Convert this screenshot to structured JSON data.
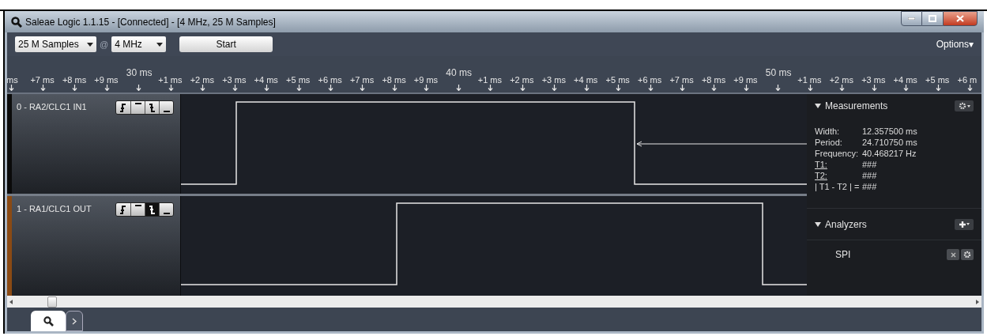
{
  "window": {
    "title": "Saleae Logic 1.1.15 - [Connected] - [4 MHz, 25 M Samples]"
  },
  "toolbar": {
    "samples": "25 M Samples",
    "at": "@",
    "rate": "4 MHz",
    "start": "Start",
    "options": "Options▾"
  },
  "ruler": {
    "ticks": [
      {
        "kind": "minor",
        "label": "ms"
      },
      {
        "kind": "minor",
        "label": "+7 ms"
      },
      {
        "kind": "minor",
        "label": "+8 ms"
      },
      {
        "kind": "minor",
        "label": "+9 ms"
      },
      {
        "kind": "major",
        "label": "30 ms"
      },
      {
        "kind": "minor",
        "label": "+1 ms"
      },
      {
        "kind": "minor",
        "label": "+2 ms"
      },
      {
        "kind": "minor",
        "label": "+3 ms"
      },
      {
        "kind": "minor",
        "label": "+4 ms"
      },
      {
        "kind": "minor",
        "label": "+5 ms"
      },
      {
        "kind": "minor",
        "label": "+6 ms"
      },
      {
        "kind": "minor",
        "label": "+7 ms"
      },
      {
        "kind": "minor",
        "label": "+8 ms"
      },
      {
        "kind": "minor",
        "label": "+9 ms"
      },
      {
        "kind": "major",
        "label": "40 ms"
      },
      {
        "kind": "minor",
        "label": "+1 ms"
      },
      {
        "kind": "minor",
        "label": "+2 ms"
      },
      {
        "kind": "minor",
        "label": "+3 ms"
      },
      {
        "kind": "minor",
        "label": "+4 ms"
      },
      {
        "kind": "minor",
        "label": "+5 ms"
      },
      {
        "kind": "minor",
        "label": "+6 ms"
      },
      {
        "kind": "minor",
        "label": "+7 ms"
      },
      {
        "kind": "minor",
        "label": "+8 ms"
      },
      {
        "kind": "minor",
        "label": "+9 ms"
      },
      {
        "kind": "major",
        "label": "50 ms"
      },
      {
        "kind": "minor",
        "label": "+1 ms"
      },
      {
        "kind": "minor",
        "label": "+2 ms"
      },
      {
        "kind": "minor",
        "label": "+3 ms"
      },
      {
        "kind": "minor",
        "label": "+4 ms"
      },
      {
        "kind": "minor",
        "label": "+5 ms"
      },
      {
        "kind": "minor",
        "label": "+6 m"
      }
    ]
  },
  "channels": [
    {
      "name": "0 - RA2/CLC1 IN1",
      "color": "#0a0a0a",
      "triggers": [
        {
          "kind": "rising",
          "selected": false
        },
        {
          "kind": "high",
          "selected": false
        },
        {
          "kind": "falling",
          "selected": false
        },
        {
          "kind": "low",
          "selected": false
        }
      ]
    },
    {
      "name": "1 - RA1/CLC1 OUT",
      "color": "#8a4a14",
      "triggers": [
        {
          "kind": "rising",
          "selected": false
        },
        {
          "kind": "high",
          "selected": false
        },
        {
          "kind": "falling",
          "selected": true
        },
        {
          "kind": "low",
          "selected": false
        }
      ]
    }
  ],
  "measurements": {
    "title": "Measurements",
    "rows": [
      {
        "label": "Width:",
        "value": "12.357500 ms",
        "link": false
      },
      {
        "label": "Period:",
        "value": "24.710750 ms",
        "link": false
      },
      {
        "label": "Frequency:",
        "value": "40.468217 Hz",
        "link": false
      },
      {
        "label": "T1:",
        "value": "###",
        "link": true
      },
      {
        "label": "T2:",
        "value": "###",
        "link": true
      },
      {
        "label": "| T1 - T2 | =",
        "value": "###",
        "link": false
      }
    ]
  },
  "analyzers": {
    "title": "Analyzers",
    "items": [
      {
        "name": "SPI"
      }
    ]
  },
  "bottom_tabs": [
    {
      "kind": "search",
      "selected": true
    },
    {
      "kind": "more",
      "selected": false
    }
  ]
}
